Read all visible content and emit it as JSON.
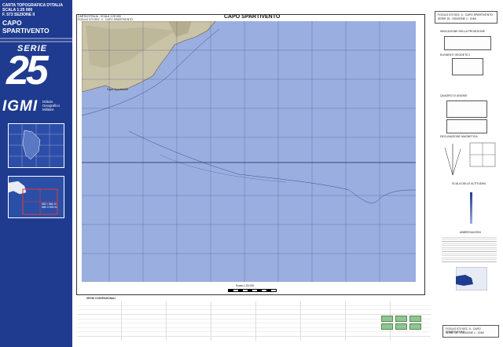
{
  "left_panel": {
    "top_lines": [
      "CARTA TOPOGRAFICA D'ITALIA",
      "SCALA 1:25 000",
      "F. 573 SEZIONE II"
    ],
    "title": "CAPO SPARTIVENTO",
    "serie_label": "SERIE",
    "serie_number": "25",
    "igmi_logo": "IGMI",
    "institute_lines": [
      "Istituto",
      "Geografico",
      "Militare"
    ],
    "index_grid": [
      [
        "583 I",
        "584 IV"
      ],
      [
        "589 II",
        "590 III"
      ]
    ],
    "colors": {
      "panel": "#1f3b8f",
      "highlight": "#e53935"
    }
  },
  "map": {
    "title": "CAPO SPARTIVENTO",
    "header_left": [
      "CARTA D'ITALIA - SCALA 1:25 000",
      "FOGLIO 573 SEZ. II - CAPO SPARTIVENTO"
    ],
    "coast_label": "Capo Spartivento",
    "scale_caption": "Scala 1:25 000",
    "colors": {
      "sea": "#9aaee0",
      "grid": "#3a4a7a",
      "land": "#c9c3a8"
    }
  },
  "right_panel": {
    "header_lines": [
      "FOGLIO 573 SEZ. II - CAPO SPARTIVENTO",
      "SERIE 25 - EDIZIONE 1 - IGMI"
    ],
    "section_titles": [
      "INDICAZIONE DELLA PROIEZIONE",
      "ELEMENTI GEODETICI",
      "QUADRO DI UNIONE",
      "DECLINAZIONE MAGNETICA",
      "SCALA DELLE ALTITUDINI",
      "ABBREVIAZIONI"
    ]
  },
  "bottom": {
    "legend_title": "SEGNI CONVENZIONALI",
    "footer_lines": [
      "FOGLIO 573 SEZ. II - CAPO SPARTIVENTO",
      "SERIE 25 - EDIZIONE 1 - IGMI"
    ]
  }
}
